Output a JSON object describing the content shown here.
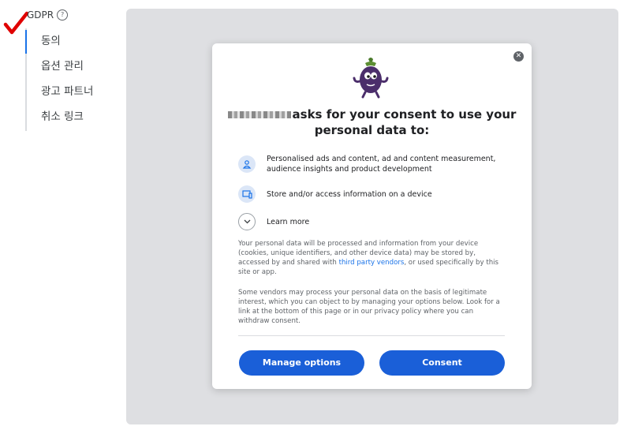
{
  "sidebar": {
    "title": "GDPR",
    "help_icon": "help-circle-icon",
    "items": [
      {
        "label": "동의",
        "active": true
      },
      {
        "label": "옵션 관리",
        "active": false
      },
      {
        "label": "광고 파트너",
        "active": false
      },
      {
        "label": "취소 링크",
        "active": false
      }
    ]
  },
  "dialog": {
    "headline_suffix": "asks for your consent to use your",
    "headline_line2": "personal data to:",
    "purposes": [
      {
        "icon": "person-icon",
        "text": "Personalised ads and content, ad and content measurement, audience insights and product development"
      },
      {
        "icon": "device-icon",
        "text": "Store and/or access information on a device"
      }
    ],
    "learn_more": "Learn more",
    "paragraph1_pre": "Your personal data will be processed and information from your device (cookies, unique identifiers, and other device data) may be stored by, accessed by and shared with ",
    "paragraph1_link": "third party vendors",
    "paragraph1_post": ", or used specifically by this site or app.",
    "paragraph2": "Some vendors may process your personal data on the basis of legitimate interest, which you can object to by managing your options below. Look for a link at the bottom of this page or in our privacy policy where you can withdraw consent.",
    "manage_button": "Manage options",
    "consent_button": "Consent"
  },
  "colors": {
    "accent": "#1a5fd8",
    "panel": "#dedfe2",
    "check": "#e00000"
  }
}
